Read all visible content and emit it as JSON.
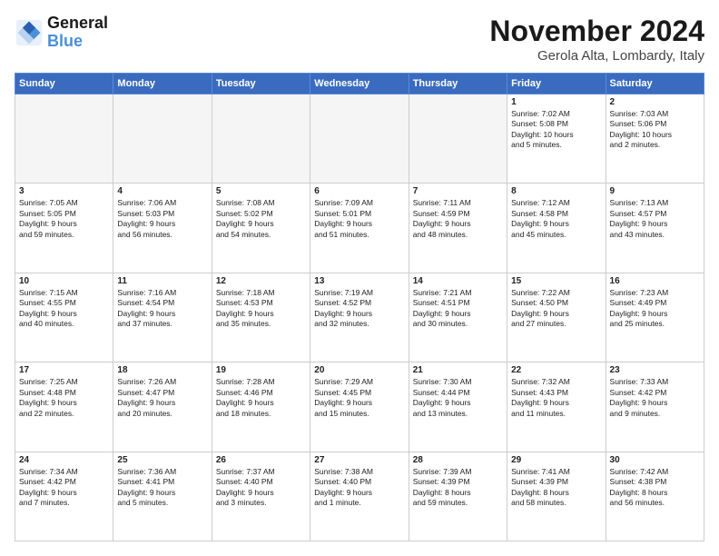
{
  "header": {
    "logo_general": "General",
    "logo_blue": "Blue",
    "month_title": "November 2024",
    "location": "Gerola Alta, Lombardy, Italy"
  },
  "days_of_week": [
    "Sunday",
    "Monday",
    "Tuesday",
    "Wednesday",
    "Thursday",
    "Friday",
    "Saturday"
  ],
  "weeks": [
    {
      "cells": [
        {
          "day": "",
          "empty": true
        },
        {
          "day": "",
          "empty": true
        },
        {
          "day": "",
          "empty": true
        },
        {
          "day": "",
          "empty": true
        },
        {
          "day": "",
          "empty": true
        },
        {
          "day": "1",
          "info": "Sunrise: 7:02 AM\nSunset: 5:08 PM\nDaylight: 10 hours\nand 5 minutes."
        },
        {
          "day": "2",
          "info": "Sunrise: 7:03 AM\nSunset: 5:06 PM\nDaylight: 10 hours\nand 2 minutes."
        }
      ]
    },
    {
      "cells": [
        {
          "day": "3",
          "info": "Sunrise: 7:05 AM\nSunset: 5:05 PM\nDaylight: 9 hours\nand 59 minutes."
        },
        {
          "day": "4",
          "info": "Sunrise: 7:06 AM\nSunset: 5:03 PM\nDaylight: 9 hours\nand 56 minutes."
        },
        {
          "day": "5",
          "info": "Sunrise: 7:08 AM\nSunset: 5:02 PM\nDaylight: 9 hours\nand 54 minutes."
        },
        {
          "day": "6",
          "info": "Sunrise: 7:09 AM\nSunset: 5:01 PM\nDaylight: 9 hours\nand 51 minutes."
        },
        {
          "day": "7",
          "info": "Sunrise: 7:11 AM\nSunset: 4:59 PM\nDaylight: 9 hours\nand 48 minutes."
        },
        {
          "day": "8",
          "info": "Sunrise: 7:12 AM\nSunset: 4:58 PM\nDaylight: 9 hours\nand 45 minutes."
        },
        {
          "day": "9",
          "info": "Sunrise: 7:13 AM\nSunset: 4:57 PM\nDaylight: 9 hours\nand 43 minutes."
        }
      ]
    },
    {
      "cells": [
        {
          "day": "10",
          "info": "Sunrise: 7:15 AM\nSunset: 4:55 PM\nDaylight: 9 hours\nand 40 minutes."
        },
        {
          "day": "11",
          "info": "Sunrise: 7:16 AM\nSunset: 4:54 PM\nDaylight: 9 hours\nand 37 minutes."
        },
        {
          "day": "12",
          "info": "Sunrise: 7:18 AM\nSunset: 4:53 PM\nDaylight: 9 hours\nand 35 minutes."
        },
        {
          "day": "13",
          "info": "Sunrise: 7:19 AM\nSunset: 4:52 PM\nDaylight: 9 hours\nand 32 minutes."
        },
        {
          "day": "14",
          "info": "Sunrise: 7:21 AM\nSunset: 4:51 PM\nDaylight: 9 hours\nand 30 minutes."
        },
        {
          "day": "15",
          "info": "Sunrise: 7:22 AM\nSunset: 4:50 PM\nDaylight: 9 hours\nand 27 minutes."
        },
        {
          "day": "16",
          "info": "Sunrise: 7:23 AM\nSunset: 4:49 PM\nDaylight: 9 hours\nand 25 minutes."
        }
      ]
    },
    {
      "cells": [
        {
          "day": "17",
          "info": "Sunrise: 7:25 AM\nSunset: 4:48 PM\nDaylight: 9 hours\nand 22 minutes."
        },
        {
          "day": "18",
          "info": "Sunrise: 7:26 AM\nSunset: 4:47 PM\nDaylight: 9 hours\nand 20 minutes."
        },
        {
          "day": "19",
          "info": "Sunrise: 7:28 AM\nSunset: 4:46 PM\nDaylight: 9 hours\nand 18 minutes."
        },
        {
          "day": "20",
          "info": "Sunrise: 7:29 AM\nSunset: 4:45 PM\nDaylight: 9 hours\nand 15 minutes."
        },
        {
          "day": "21",
          "info": "Sunrise: 7:30 AM\nSunset: 4:44 PM\nDaylight: 9 hours\nand 13 minutes."
        },
        {
          "day": "22",
          "info": "Sunrise: 7:32 AM\nSunset: 4:43 PM\nDaylight: 9 hours\nand 11 minutes."
        },
        {
          "day": "23",
          "info": "Sunrise: 7:33 AM\nSunset: 4:42 PM\nDaylight: 9 hours\nand 9 minutes."
        }
      ]
    },
    {
      "cells": [
        {
          "day": "24",
          "info": "Sunrise: 7:34 AM\nSunset: 4:42 PM\nDaylight: 9 hours\nand 7 minutes."
        },
        {
          "day": "25",
          "info": "Sunrise: 7:36 AM\nSunset: 4:41 PM\nDaylight: 9 hours\nand 5 minutes."
        },
        {
          "day": "26",
          "info": "Sunrise: 7:37 AM\nSunset: 4:40 PM\nDaylight: 9 hours\nand 3 minutes."
        },
        {
          "day": "27",
          "info": "Sunrise: 7:38 AM\nSunset: 4:40 PM\nDaylight: 9 hours\nand 1 minute."
        },
        {
          "day": "28",
          "info": "Sunrise: 7:39 AM\nSunset: 4:39 PM\nDaylight: 8 hours\nand 59 minutes."
        },
        {
          "day": "29",
          "info": "Sunrise: 7:41 AM\nSunset: 4:39 PM\nDaylight: 8 hours\nand 58 minutes."
        },
        {
          "day": "30",
          "info": "Sunrise: 7:42 AM\nSunset: 4:38 PM\nDaylight: 8 hours\nand 56 minutes."
        }
      ]
    }
  ]
}
